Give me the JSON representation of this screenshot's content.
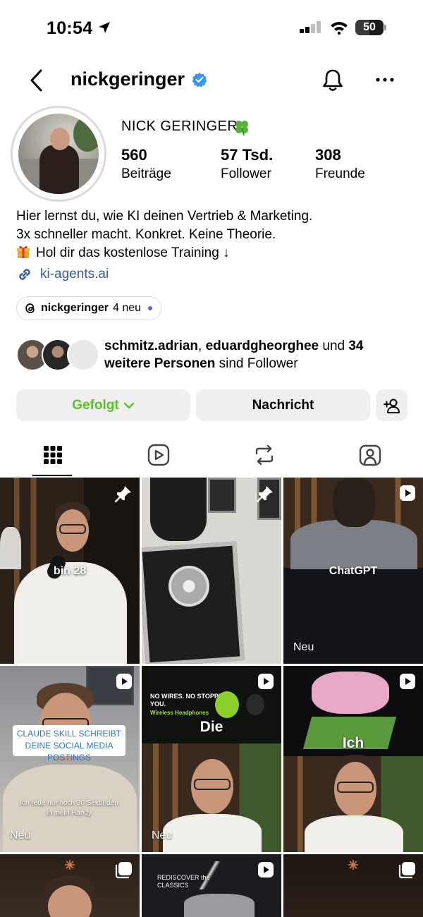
{
  "status": {
    "time": "10:54",
    "battery": "50",
    "battery_level": 0.5
  },
  "header": {
    "username": "nickgeringer"
  },
  "profile": {
    "display_name": "NICK GERINGER",
    "stats": [
      {
        "value": "560",
        "label": "Beiträge"
      },
      {
        "value": "57 Tsd.",
        "label": "Follower"
      },
      {
        "value": "308",
        "label": "Freunde"
      }
    ],
    "bio": [
      "Hier lernst du, wie KI deinen Vertrieb & Marketing.",
      "3x schneller macht. Konkret. Keine Theorie.",
      "Hol dir das kostenlose Training ↓"
    ],
    "link": "ki-agents.ai",
    "threads": {
      "handle": "nickgeringer",
      "new": "4 neu"
    },
    "mutual": {
      "user1": "schmitz.adrian",
      "sep": ",",
      "user2": "eduardgheorghee",
      "und": "und",
      "count": "34",
      "weitere": "weitere Personen",
      "suffix": "sind Follower"
    }
  },
  "buttons": {
    "follow": "Gefolgt",
    "message": "Nachricht"
  },
  "tabs": [
    {
      "name": "posts",
      "icon": "grid-icon",
      "active": true
    },
    {
      "name": "reels",
      "icon": "reels-icon",
      "active": false
    },
    {
      "name": "reposts",
      "icon": "repost-icon",
      "active": false
    },
    {
      "name": "tagged",
      "icon": "tagged-icon",
      "active": false
    }
  ],
  "posts": [
    {
      "overlay": "bin 28",
      "badge": "pin-icon"
    },
    {
      "overlay": "",
      "badge": "pin-icon"
    },
    {
      "overlay": "ChatGPT",
      "badge": "reel-icon",
      "new_label": "Neu"
    },
    {
      "overlay": "CLAUDE SKILL SCHREIBT DEINE SOCIAL MEDIA POSTINGS",
      "caption": "Ich rede nur noch 30 Sekunden in mein Handy",
      "badge": "reel-icon",
      "new_label": "Neu"
    },
    {
      "overlay": "Die",
      "badge": "reel-icon",
      "new_label": "Neu",
      "screen_text": "NO WIRES. NO STOPPING YOU.",
      "screen_sub": "Wireless Headphones"
    },
    {
      "overlay": "Ich",
      "badge": "reel-icon"
    },
    {
      "overlay": "",
      "badge": "carousel-icon"
    },
    {
      "overlay": "",
      "badge": "reel-icon",
      "screen_text": "REDISCOVER the CLASSICS"
    },
    {
      "overlay": "",
      "badge": "carousel-icon"
    }
  ]
}
